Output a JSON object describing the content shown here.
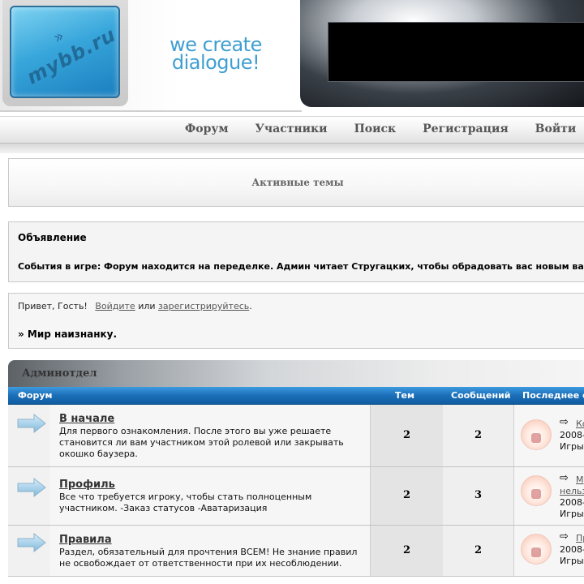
{
  "header": {
    "logo_text": "mybb.ru",
    "tagline_line1": "we create",
    "tagline_line2": "dialogue!"
  },
  "nav": {
    "items": [
      "Форум",
      "Участники",
      "Поиск",
      "Регистрация",
      "Войти"
    ]
  },
  "active_topics": {
    "title": "Активные темы"
  },
  "announcement": {
    "title": "Объявление",
    "text": "События в игре: Форум находится на переделке. Админ читает Стругацких, чтобы обрадовать вас новым ва"
  },
  "welcome": {
    "greeting": "Привет, Гость!",
    "login_link": "Войдите",
    "or": "или",
    "register_link": "зарегистрируйтесь",
    "period": ".",
    "world_title": "» Мир наизнанку."
  },
  "category": {
    "title": "Админотдел",
    "columns": {
      "forum": "Форум",
      "topics": "Тем",
      "posts": "Сообщений",
      "last": "Последнее с"
    },
    "accent_color": "#1b6fb8",
    "forums": [
      {
        "name": "В начале",
        "description": "Для первого ознакомления. После этого вы уже решаете становится ли вам участником этой ролевой или закрывать окошко баузера.",
        "topics": "2",
        "posts": "2",
        "last_link": "Ко",
        "last_link_line2": "",
        "last_date": "2008-",
        "last_user": "Игры"
      },
      {
        "name": "Профиль",
        "description": "Все что требуется игроку, чтобы стать полноценным участником. -Заказ статусов -Аватаризация",
        "topics": "2",
        "posts": "3",
        "last_link": "М",
        "last_link_line2": "нельз",
        "last_date": "2008-",
        "last_user": "Игры"
      },
      {
        "name": "Правила",
        "description": "Раздел, обязательный для прочтения ВСЕМ! Не знание правил не освобождает от ответственности при их несоблюдении.",
        "topics": "2",
        "posts": "2",
        "last_link": "Пр",
        "last_link_line2": "",
        "last_date": "2008-",
        "last_user": "Игры"
      }
    ]
  },
  "icons": {
    "forum_arrow": "forum-arrow-icon",
    "last_post_arrow": "last-post-arrow-icon",
    "avatar": "user-avatar-icon"
  }
}
